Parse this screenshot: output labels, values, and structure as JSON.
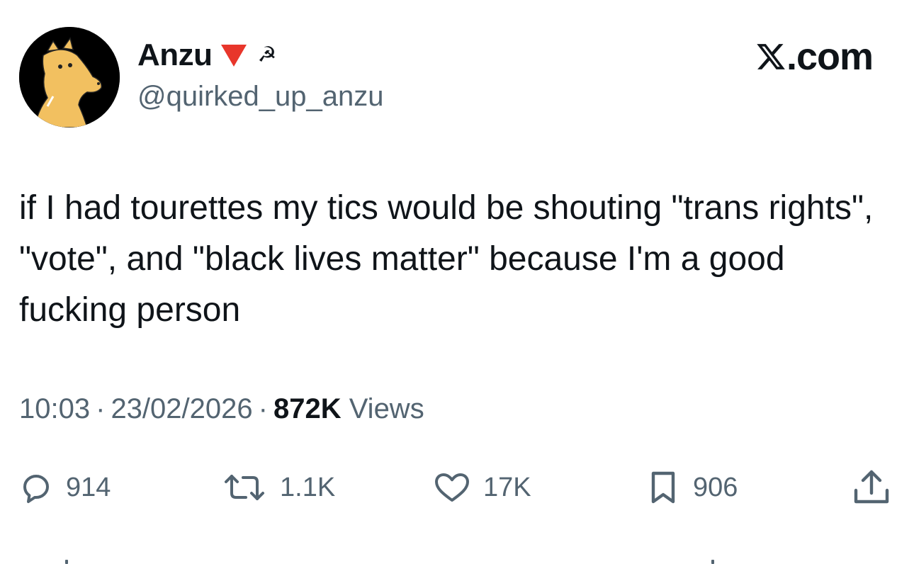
{
  "header": {
    "display_name": "Anzu",
    "emojis": [
      "red-triangle-down-icon",
      "hammer-sickle-icon"
    ],
    "handle": "@quirked_up_anzu",
    "brand": ".com",
    "brand_icon": "x-logo-icon"
  },
  "tweet": {
    "text": "if I had tourettes my tics would be shouting \"trans rights\", \"vote\", and \"black lives matter\" because I'm a good fucking person",
    "time": "10:03",
    "separator": "·",
    "date": "23/02/2026",
    "views_count": "872K",
    "views_label": "Views"
  },
  "actions": {
    "reply": {
      "icon": "reply-bubble-icon",
      "count": "914"
    },
    "repost": {
      "icon": "repost-icon",
      "count": "1.1K"
    },
    "like": {
      "icon": "heart-icon",
      "count": "17K"
    },
    "bookmark": {
      "icon": "bookmark-icon",
      "count": "906"
    },
    "share": {
      "icon": "share-upload-icon"
    }
  },
  "colors": {
    "text_primary": "#0f1419",
    "text_secondary": "#536471",
    "flag_red": "#e8362b",
    "avatar_bg": "#000000",
    "avatar_figure": "#f2c060"
  }
}
